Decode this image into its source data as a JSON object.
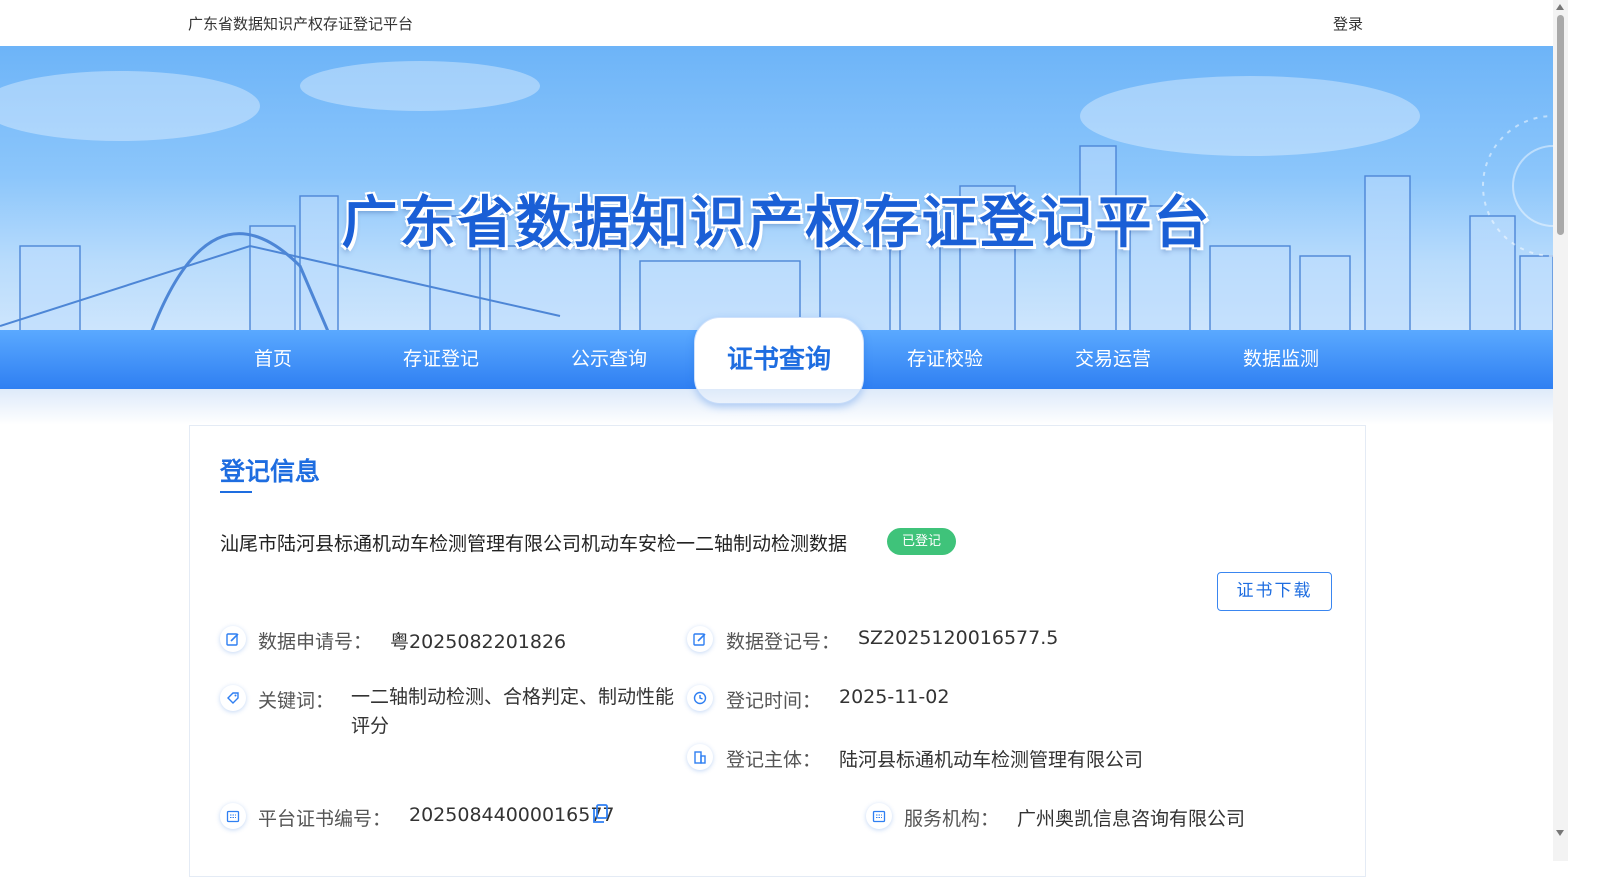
{
  "header": {
    "site_name": "广东省数据知识产权存证登记平台",
    "login": "登录"
  },
  "banner": {
    "title": "广东省数据知识产权存证登记平台"
  },
  "nav": {
    "items": [
      {
        "label": "首页"
      },
      {
        "label": "存证登记"
      },
      {
        "label": "公示查询"
      },
      {
        "label": "证书查询",
        "active": true
      },
      {
        "label": "存证校验"
      },
      {
        "label": "交易运营"
      },
      {
        "label": "数据监测"
      }
    ]
  },
  "record": {
    "section_title": "登记信息",
    "title": "汕尾市陆河县标通机动车检测管理有限公司机动车安检一二轴制动检测数据",
    "status": "已登记",
    "download_label": "证书下载",
    "fields": {
      "application_no": {
        "label": "数据申请号：",
        "value": "粤2025082201826"
      },
      "registration_no": {
        "label": "数据登记号：",
        "value": "SZ2025120016577.5"
      },
      "keywords": {
        "label": "关键词：",
        "value": "一二轴制动检测、合格判定、制动性能评分"
      },
      "registration_time": {
        "label": "登记时间：",
        "value": "2025-11-02"
      },
      "registrant": {
        "label": "登记主体：",
        "value": "陆河县标通机动车检测管理有限公司"
      },
      "certificate_no": {
        "label": "平台证书编号：",
        "value": "20250844000016577"
      },
      "service_org": {
        "label": "服务机构：",
        "value": "广州奥凯信息咨询有限公司"
      }
    }
  },
  "colors": {
    "primary": "#1e6de0",
    "nav_bg": "#2f7ff2",
    "status_green": "#3fc37a"
  }
}
